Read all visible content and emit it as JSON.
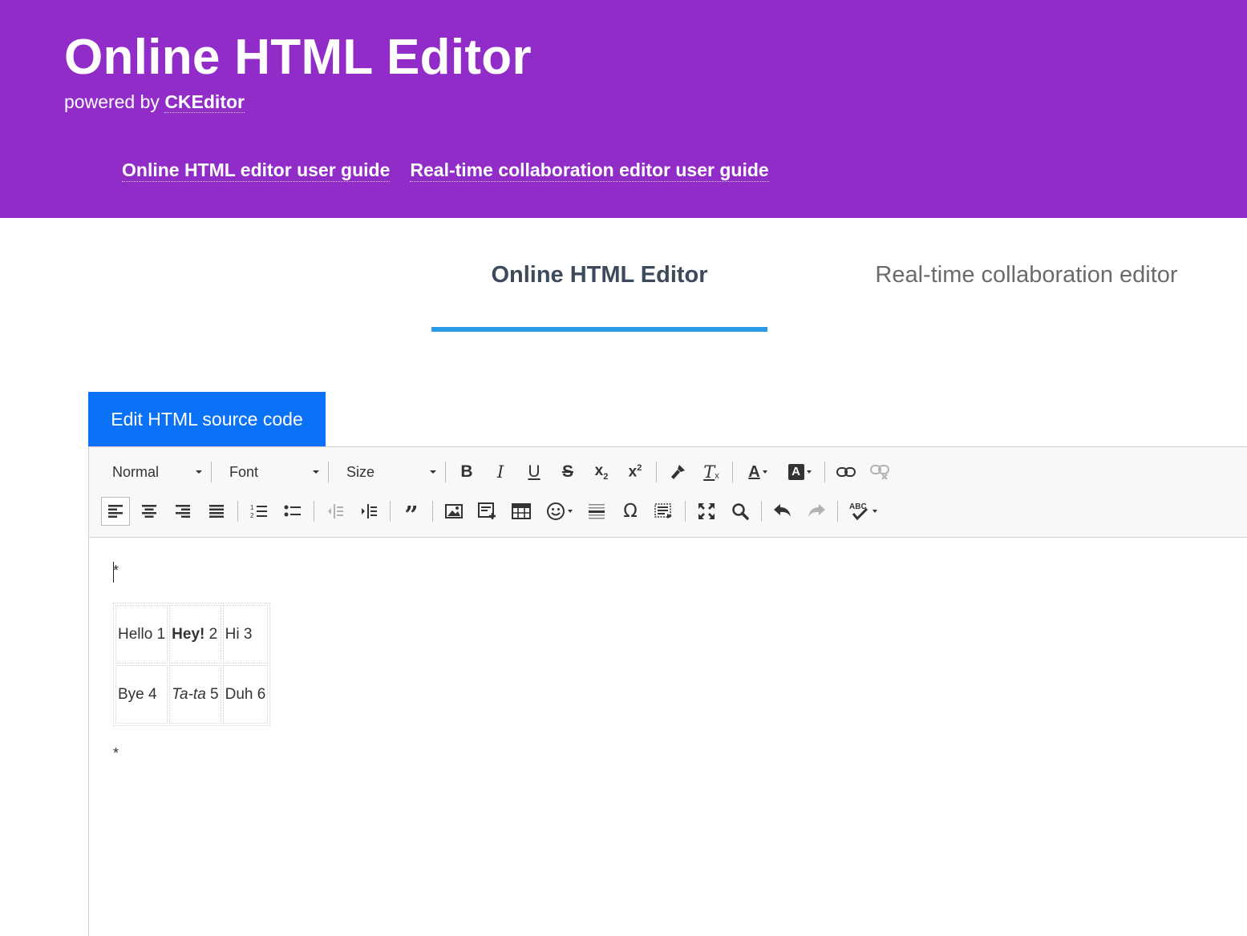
{
  "header": {
    "title": "Online HTML Editor",
    "subtitle_prefix": "powered by ",
    "brand": "CKEditor",
    "links": [
      "Online HTML editor user guide",
      "Real-time collaboration editor user guide"
    ],
    "bg_color": "#922cc8"
  },
  "tabs": [
    {
      "label": "Online HTML Editor",
      "active": true
    },
    {
      "label": "Real-time collaboration editor",
      "active": false
    }
  ],
  "source_button": {
    "label": "Edit HTML source code",
    "color": "#0b71f7"
  },
  "toolbar": {
    "format": "Normal",
    "font": "Font",
    "size": "Size",
    "row1_icons": [
      "bold-icon",
      "italic-icon",
      "underline-icon",
      "strikethrough-icon",
      "subscript-icon",
      "superscript-icon",
      "copy-format-icon",
      "remove-format-icon",
      "text-color-icon",
      "background-color-icon",
      "link-icon",
      "unlink-icon"
    ],
    "row2_icons": [
      "align-left-icon",
      "align-center-icon",
      "align-right-icon",
      "justify-icon",
      "numbered-list-icon",
      "bulleted-list-icon",
      "decrease-indent-icon",
      "increase-indent-icon",
      "blockquote-icon",
      "image-icon",
      "embed-icon",
      "table-icon",
      "emoji-icon",
      "horizontal-line-icon",
      "special-char-icon",
      "show-blocks-icon",
      "maximize-icon",
      "find-icon",
      "undo-icon",
      "redo-icon",
      "spellcheck-icon"
    ]
  },
  "content": {
    "marker_top": "*",
    "marker_bottom": "*",
    "table": [
      [
        {
          "bold": "",
          "italic": "",
          "text": "Hello 1"
        },
        {
          "bold": "Hey!",
          "italic": "",
          "text": " 2"
        },
        {
          "bold": "",
          "italic": "",
          "text": "Hi 3"
        }
      ],
      [
        {
          "bold": "",
          "italic": "",
          "text": "Bye 4"
        },
        {
          "bold": "",
          "italic": "Ta-ta",
          "text": " 5"
        },
        {
          "bold": "",
          "italic": "",
          "text": "Duh 6"
        }
      ]
    ]
  },
  "colors": {
    "accent_tab": "#2b9be8",
    "active_tab_text": "#3d4a5c"
  }
}
